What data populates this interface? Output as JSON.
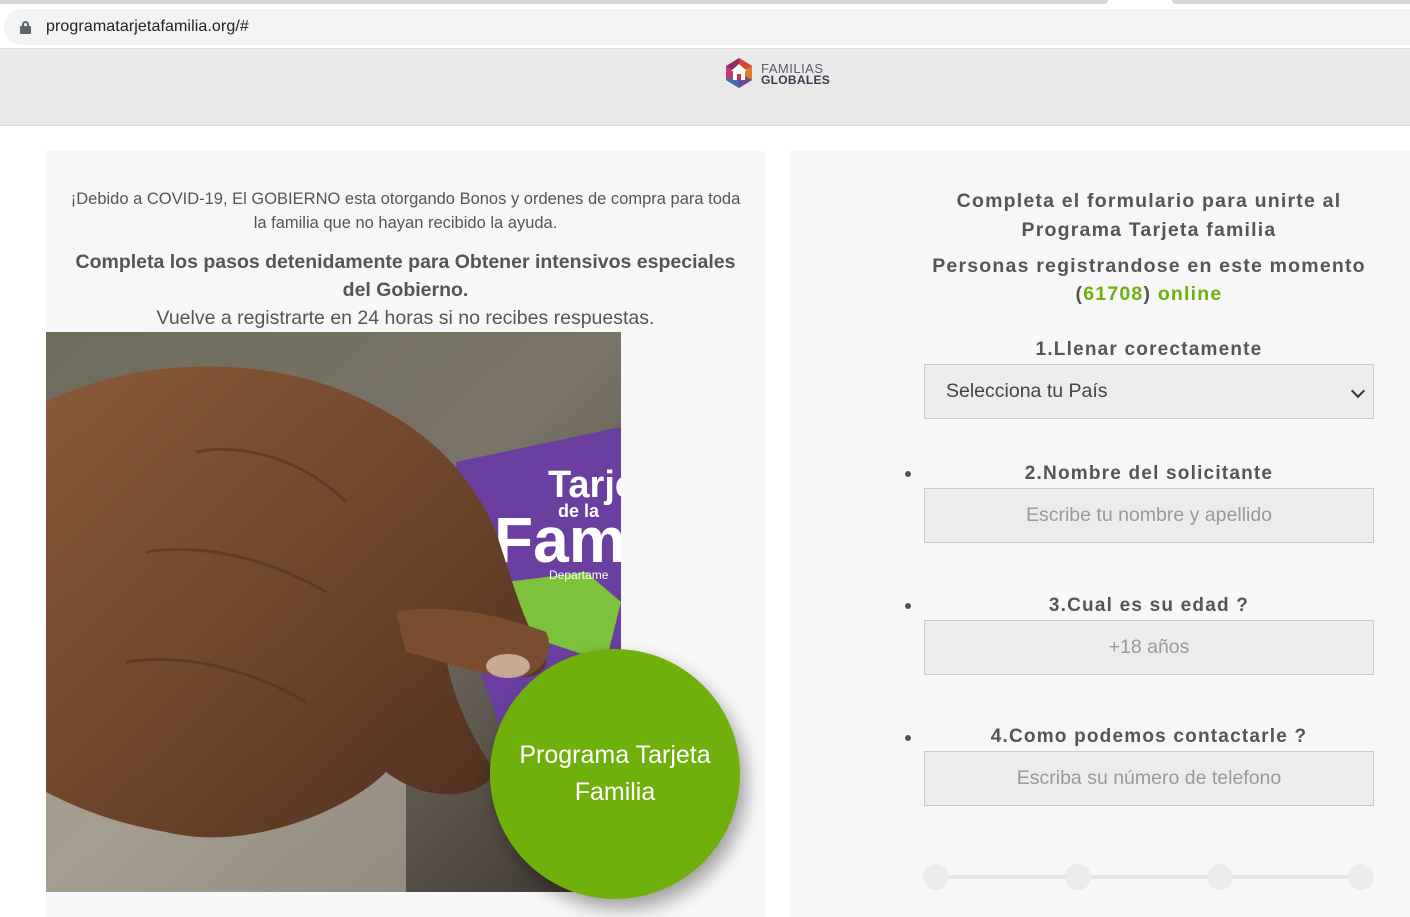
{
  "browser": {
    "url": "programatarjetafamilia.org/#"
  },
  "header": {
    "logo_line1": "FAMILIAS",
    "logo_line2": "GLOBALES"
  },
  "left": {
    "intro": "¡Debido a COVID-19, El GOBIERNO esta otorgando Bonos y ordenes de compra para toda la familia que no hayan recibido la ayuda.",
    "bold": "Completa los pasos detenidamente para Obtener intensivos especiales del Gobierno.",
    "retry": "Vuelve a registrarte en 24 horas si no recibes respuestas.",
    "card_text_1": "Tarje",
    "card_text_2": "de la",
    "card_text_3": "Fam",
    "card_text_4": "Departame",
    "circle_label": "Programa Tarjeta Familia"
  },
  "form": {
    "title": "Completa el formulario para unirte al Programa Tarjeta familia",
    "people_prefix": "Personas registrandose en este momento",
    "open_paren": "(",
    "count": "61708",
    "close_paren": ")",
    "online": "online",
    "step1_label": "1.Llenar corectamente",
    "country_select": "Selecciona tu País",
    "step2_label": "2.Nombre del solicitante",
    "name_placeholder": "Escribe tu nombre y apellido",
    "step3_label": "3.Cual es su edad ?",
    "age_placeholder": "+18 años",
    "step4_label": "4.Como podemos contactarle ?",
    "phone_placeholder": "Escriba su número de telefono",
    "progress_steps": 4,
    "accent_color": "#70b00c"
  }
}
